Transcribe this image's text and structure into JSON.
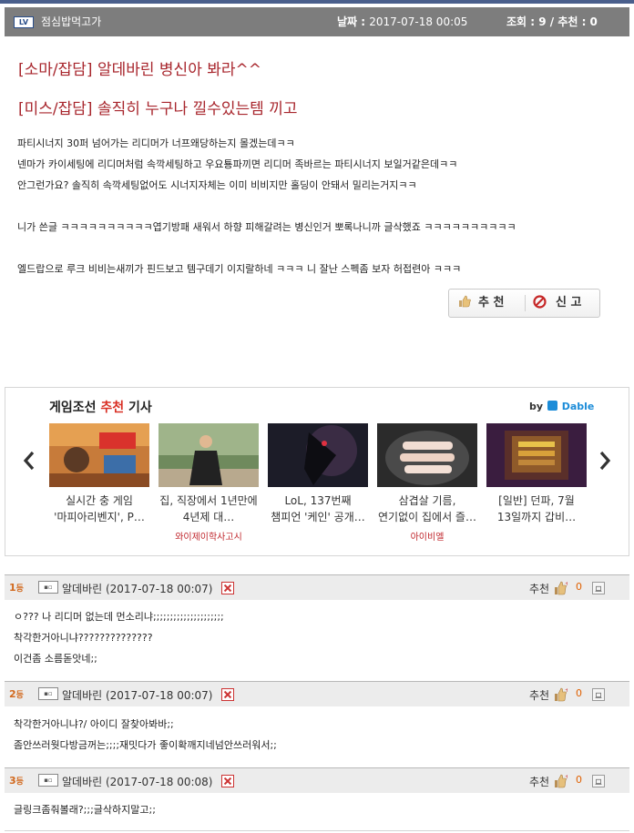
{
  "header": {
    "level_badge": "LV",
    "nickname": "점심밥먹고가",
    "date_label": "날짜 : ",
    "date_value": "2017-07-18 00:05",
    "stats": "조회 : 9 / 추천 : 0"
  },
  "post": {
    "titles": [
      "[소마/잡담] 알데바린 병신아 봐라^^",
      "[미스/잡담] 솔직히 누구나 낄수있는템 끼고"
    ],
    "lines": [
      "파티시너지 30퍼 넘어가는 리디머가 너프왜당하는지 몰겠는데ㅋㅋ",
      "넨마가 카이세팅에 리디머처럼 속깍세팅하고 우요툥파끼면 리디머 족바르는 파티시너지 보일거같은데ㅋㅋ",
      "안그런가요? 솔직히 속깍세팅없어도 시너지자체는 이미 비비지만 홀딩이 안돼서 밀리는거지ㅋㅋ",
      "니가 쓴글 ㅋㅋㅋㅋㅋㅋㅋㅋㅋㅋ엽기방패 새워서 하향 피해갈려는 병신인거 뽀록나니까 글삭했죠 ㅋㅋㅋㅋㅋㅋㅋㅋㅋㅋ",
      "엘드랍으로 루크 비비는새끼가 핀드보고 템구데기 이지랄하네 ㅋㅋㅋ 니 잘난 스펙좀 보자 허접련아 ㅋㅋㅋ"
    ],
    "recommend_label": "추 천",
    "report_label": "신 고"
  },
  "recommend_panel": {
    "title_prefix": "게임조선 ",
    "title_highlight": "추천",
    "title_suffix": " 기사",
    "by_label": "by",
    "provider": "Dable",
    "cards": [
      {
        "title": "실시간 충 게임 '마피아리벤지', P…",
        "source": ""
      },
      {
        "title": "집, 직장에서 1년만에 4년제 대…",
        "source": "와이제이학사고시"
      },
      {
        "title": "LoL, 137번째 챔피언 '케인' 공개…",
        "source": ""
      },
      {
        "title": "삼겹살 기름, 연기없이 집에서 즐…",
        "source": "아이비엘"
      },
      {
        "title": "[일반] 던파, 7월 13일까지 갑비…",
        "source": ""
      }
    ]
  },
  "comments": [
    {
      "rank": "1",
      "rank_suffix": "등",
      "nickname": "알데바린 (2017-07-18 00:07)",
      "recommend_label": "추천",
      "recommend_count": "0",
      "lines": [
        "ㅇ??? 나 리디머 없는데 먼소리냐;;;;;;;;;;;;;;;;;;;;;",
        "착각한거아니냐??????????????",
        "이건좀 소름돋앗네;;"
      ]
    },
    {
      "rank": "2",
      "rank_suffix": "등",
      "nickname": "알데바린 (2017-07-18 00:07)",
      "recommend_label": "추천",
      "recommend_count": "0",
      "lines": [
        "착각한거아니냐?/ 아이디 잘찾아봐바;;",
        "좀안쓰러웟다방금꺼는;;;;재밋다가 좋이확깨지네넘안쓰러워서;;"
      ]
    },
    {
      "rank": "3",
      "rank_suffix": "등",
      "nickname": "알데바린 (2017-07-18 00:08)",
      "recommend_label": "추천",
      "recommend_count": "0",
      "lines": [
        "글링크좀줘볼래?;;;글삭하지말고;;"
      ]
    }
  ]
}
